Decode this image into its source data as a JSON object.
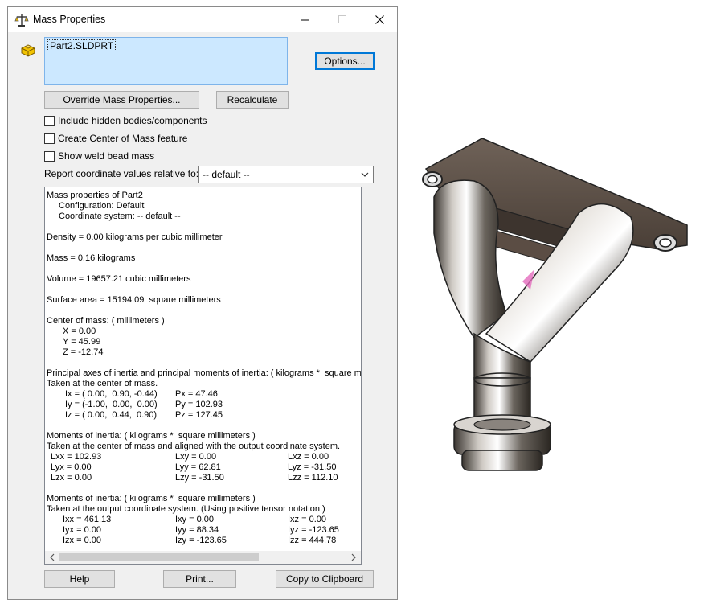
{
  "window": {
    "title": "Mass Properties"
  },
  "selection": {
    "items": [
      "Part2.SLDPRT"
    ]
  },
  "buttons": {
    "options": "Options...",
    "override": "Override Mass Properties...",
    "recalculate": "Recalculate",
    "help": "Help",
    "print": "Print...",
    "copy": "Copy to Clipboard"
  },
  "checkboxes": {
    "hidden_bodies": {
      "label": "Include hidden bodies/components",
      "checked": false
    },
    "center_of_mass": {
      "label": "Create Center of Mass feature",
      "checked": false
    },
    "weld_bead": {
      "label": "Show weld bead mass",
      "checked": false
    }
  },
  "coordinates": {
    "label": "Report coordinate values relative to:",
    "selected": "-- default --"
  },
  "report": {
    "title": "Mass properties of Part2",
    "configuration": "Configuration: Default",
    "coordinate_system": "Coordinate system: -- default --",
    "density": "Density = 0.00 kilograms per cubic millimeter",
    "mass": "Mass = 0.16 kilograms",
    "volume": "Volume = 19657.21 cubic millimeters",
    "surface_area": "Surface area = 15194.09  square millimeters",
    "com_title": "Center of mass: ( millimeters )",
    "com_x": "X = 0.00",
    "com_y": "Y = 45.99",
    "com_z": "Z = -12.74",
    "principal_title": "Principal axes of inertia and principal moments of inertia: ( kilograms *  square millimeters )",
    "principal_sub": "Taken at the center of mass.",
    "ix": "Ix = ( 0.00,  0.90, -0.44)",
    "iy": "Iy = (-1.00,  0.00,  0.00)",
    "iz": "Iz = ( 0.00,  0.44,  0.90)",
    "px": "Px = 47.46",
    "py": "Py = 102.93",
    "pz": "Pz = 127.45",
    "moi_com_title": "Moments of inertia: ( kilograms *  square millimeters )",
    "moi_com_sub": "Taken at the center of mass and aligned with the output coordinate system.",
    "moi_com": [
      [
        "Lxx = 102.93",
        "Lxy = 0.00",
        "Lxz = 0.00"
      ],
      [
        "Lyx = 0.00",
        "Lyy = 62.81",
        "Lyz = -31.50"
      ],
      [
        "Lzx = 0.00",
        "Lzy = -31.50",
        "Lzz = 112.10"
      ]
    ],
    "moi_out_title": "Moments of inertia: ( kilograms *  square millimeters )",
    "moi_out_sub": "Taken at the output coordinate system. (Using positive tensor notation.)",
    "moi_out": [
      [
        "Ixx = 461.13",
        "Ixy = 0.00",
        "Ixz = 0.00"
      ],
      [
        "Iyx = 0.00",
        "Iyy = 88.34",
        "Iyz = -123.65"
      ],
      [
        "Izx = 0.00",
        "Izy = -123.65",
        "Izz = 444.78"
      ]
    ]
  }
}
